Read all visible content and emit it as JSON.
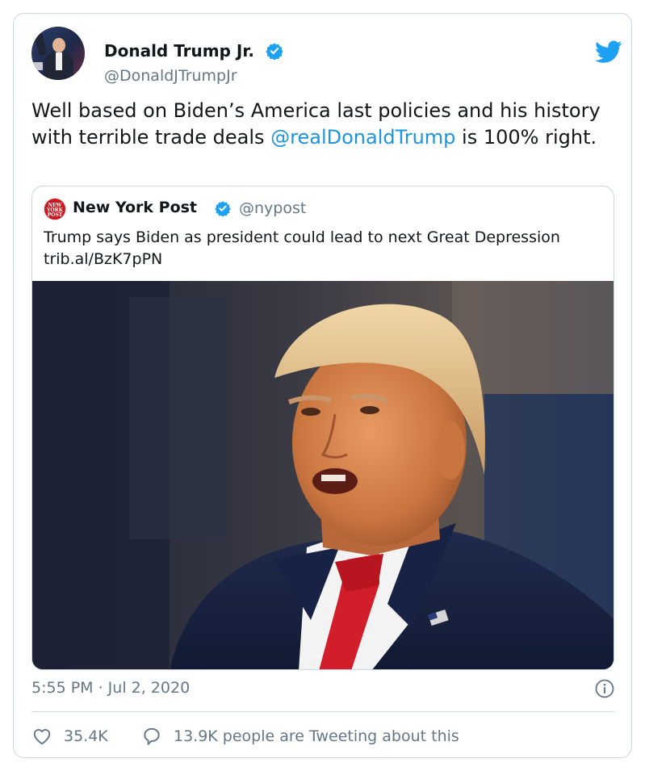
{
  "tweet": {
    "author_name": "Donald Trump Jr.",
    "handle": "@DonaldJTrumpJr",
    "text_before": "Well based on Biden’s America last policies and his history with terrible trade deals ",
    "mention": "@realDonaldTrump",
    "text_after": " is 100% right.",
    "timestamp": "5:55 PM · Jul 2, 2020",
    "likes": "35.4K",
    "conversation": "13.9K people are Tweeting about this"
  },
  "quote": {
    "name": "New York Post",
    "handle": "@nypost",
    "text": "Trump says Biden as president could lead to next Great Depression trib.al/BzK7pPN",
    "avatar_text": "NEW YORK POST"
  },
  "icons": {
    "verified": "verified-badge-icon",
    "brand": "twitter-bird-icon",
    "info": "info-icon",
    "like": "heart-icon",
    "reply": "speech-bubble-icon"
  },
  "colors": {
    "accent": "#1da1f2",
    "mention": "#1b95e0",
    "secondary_text": "#657786",
    "border": "#ccd6dd"
  }
}
